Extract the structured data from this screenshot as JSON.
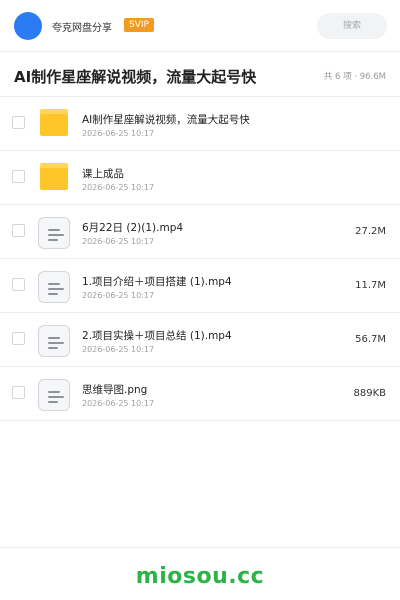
{
  "header": {
    "brand": "夸克网盘分享",
    "badge": "SVIP",
    "search_placeholder": "搜索"
  },
  "titlebar": {
    "title": "AI制作星座解说视频，流量大起号快",
    "summary": "共 6 项 · 96.6M"
  },
  "files": [
    {
      "name": "AI制作星座解说视频，流量大起号快",
      "date": "2026-06-25 10:17",
      "size": "",
      "icon": "folder-icon"
    },
    {
      "name": "课上成品",
      "date": "2026-06-25 10:17",
      "size": "",
      "icon": "folder-icon"
    },
    {
      "name": "6月22日 (2)(1).mp4",
      "date": "2026-06-25 10:17",
      "size": "27.2M",
      "icon": "file-icon"
    },
    {
      "name": "1.项目介绍＋项目搭建 (1).mp4",
      "date": "2026-06-25 10:17",
      "size": "11.7M",
      "icon": "file-icon"
    },
    {
      "name": "2.项目实操＋项目总结 (1).mp4",
      "date": "2026-06-25 10:17",
      "size": "56.7M",
      "icon": "file-icon"
    },
    {
      "name": "思维导图.png",
      "date": "2026-06-25 10:17",
      "size": "889KB",
      "icon": "file-icon"
    }
  ],
  "footer": {
    "watermark": "miosou.cc"
  },
  "colors": {
    "avatar": "#2b7bf2",
    "svip": "#f39a23",
    "folder": "#ffc629",
    "watermark": "#2db34a"
  }
}
